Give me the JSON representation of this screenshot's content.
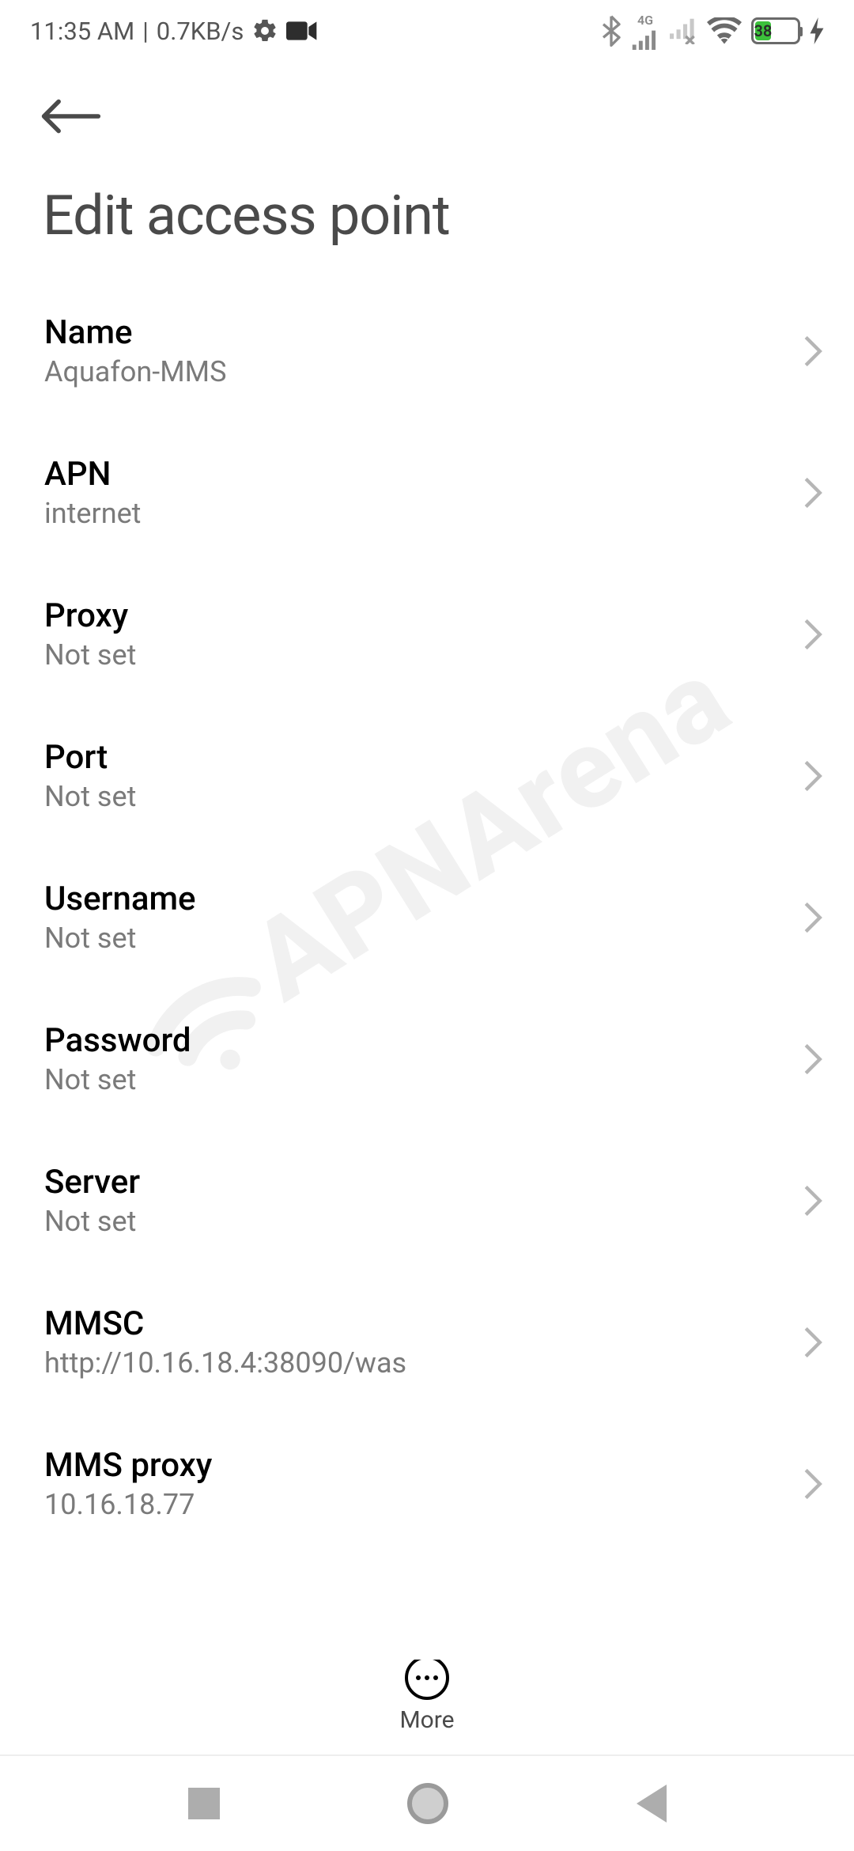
{
  "status_bar": {
    "time": "11:35 AM",
    "separator": "|",
    "data_rate": "0.7KB/s",
    "network_label_4g": "4G",
    "battery_pct": "38",
    "battery_fill_width": "38%"
  },
  "page": {
    "title": "Edit access point"
  },
  "rows": [
    {
      "key": "name",
      "label": "Name",
      "value": "Aquafon-MMS"
    },
    {
      "key": "apn",
      "label": "APN",
      "value": "internet"
    },
    {
      "key": "proxy",
      "label": "Proxy",
      "value": "Not set"
    },
    {
      "key": "port",
      "label": "Port",
      "value": "Not set"
    },
    {
      "key": "username",
      "label": "Username",
      "value": "Not set"
    },
    {
      "key": "password",
      "label": "Password",
      "value": "Not set"
    },
    {
      "key": "server",
      "label": "Server",
      "value": "Not set"
    },
    {
      "key": "mmsc",
      "label": "MMSC",
      "value": "http://10.16.18.4:38090/was"
    },
    {
      "key": "mms-proxy",
      "label": "MMS proxy",
      "value": "10.16.18.77"
    }
  ],
  "bottom": {
    "more_label": "More"
  },
  "watermark": {
    "text": "APNArena"
  }
}
